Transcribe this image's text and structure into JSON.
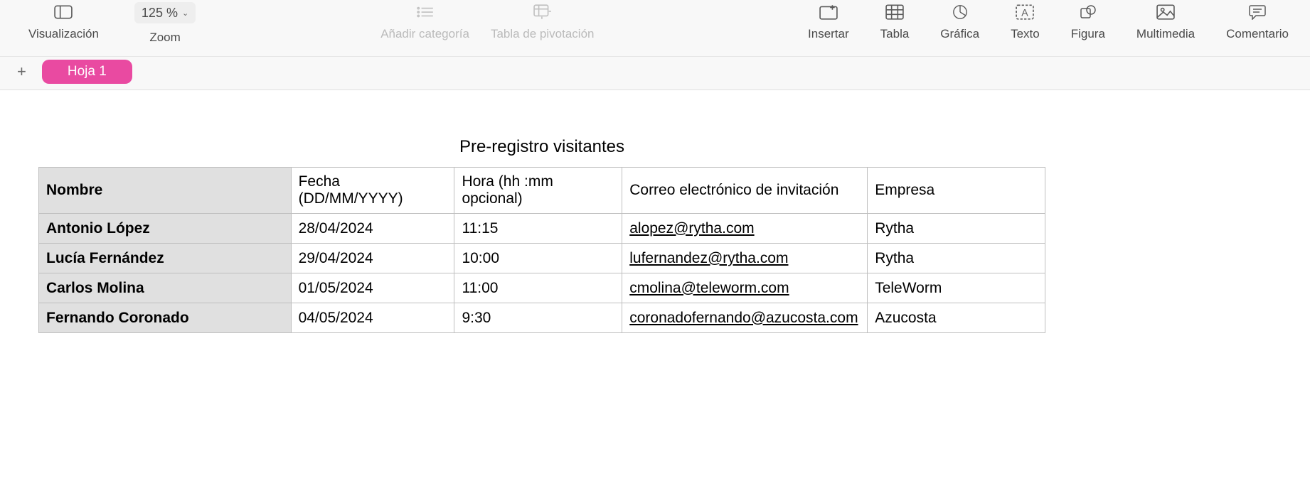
{
  "toolbar": {
    "view_label": "Visualización",
    "zoom_label": "Zoom",
    "zoom_value": "125 %",
    "add_category_label": "Añadir categoría",
    "pivot_label": "Tabla de pivotación",
    "insert_label": "Insertar",
    "table_label": "Tabla",
    "chart_label": "Gráfica",
    "text_label": "Texto",
    "shape_label": "Figura",
    "media_label": "Multimedia",
    "comment_label": "Comentario"
  },
  "sheet": {
    "name": "Hoja 1",
    "add_glyph": "+"
  },
  "table": {
    "title": "Pre-registro visitantes",
    "headers": {
      "name": "Nombre",
      "date": "Fecha (DD/MM/YYYY)",
      "time": "Hora (hh :mm opcional)",
      "email": "Correo electrónico de invitación",
      "company": "Empresa"
    },
    "rows": [
      {
        "name": "Antonio López",
        "date": "28/04/2024",
        "time": "11:15",
        "email": "alopez@rytha.com",
        "company": "Rytha"
      },
      {
        "name": "Lucía Fernández",
        "date": "29/04/2024",
        "time": "10:00",
        "email": "lufernandez@rytha.com",
        "company": "Rytha"
      },
      {
        "name": "Carlos Molina",
        "date": "01/05/2024",
        "time": "11:00",
        "email": "cmolina@teleworm.com",
        "company": "TeleWorm"
      },
      {
        "name": "Fernando Coronado",
        "date": "04/05/2024",
        "time": "9:30",
        "email": "coronadofernando@azucosta.com",
        "company": "Azucosta"
      }
    ]
  }
}
